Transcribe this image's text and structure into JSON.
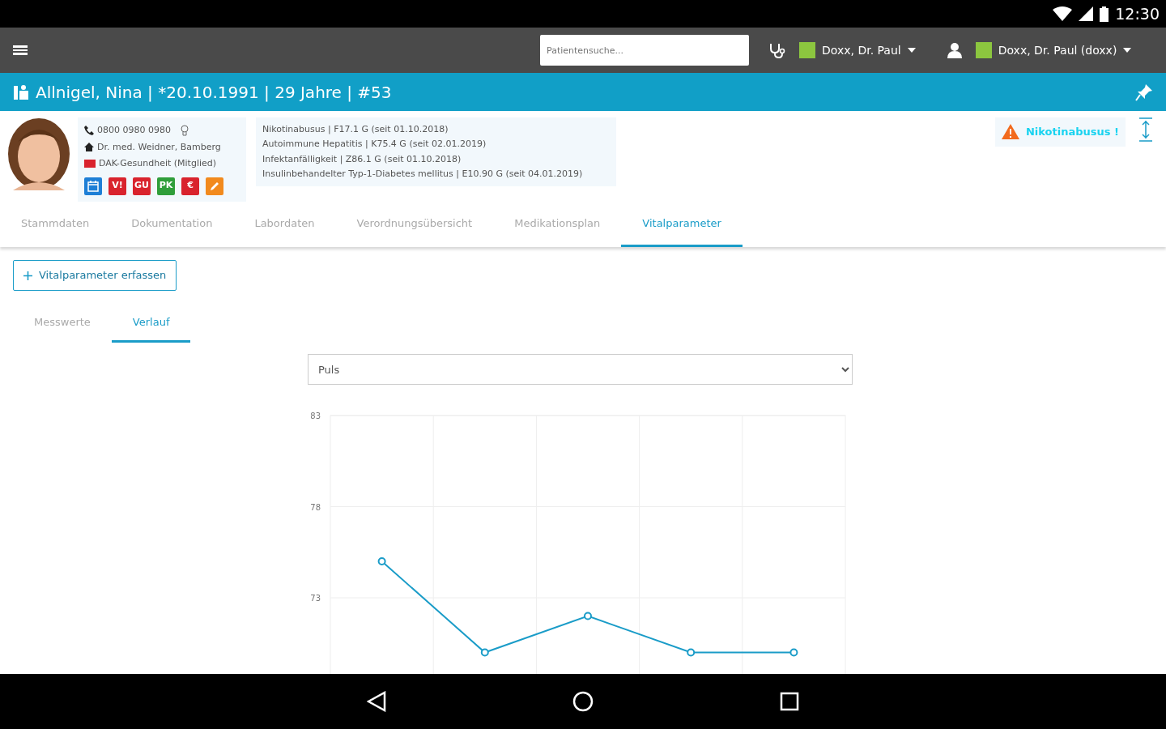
{
  "status_bar": {
    "time": "12:30"
  },
  "toolbar": {
    "search": {
      "placeholder": "Patientensuche..."
    },
    "doctor": {
      "label": "Doxx, Dr. Paul",
      "color": "#8cc63f"
    },
    "user": {
      "label": "Doxx, Dr. Paul (doxx)",
      "color": "#8cc63f"
    }
  },
  "patient": {
    "title": "Allnigel, Nina | *20.10.1991 | 29 Jahre | #53",
    "phone": "0800 0980 0980",
    "doctor": "Dr. med. Weidner, Bamberg",
    "insurance": "DAK-Gesundheit (Mitglied)",
    "badges": [
      {
        "kind": "calendar",
        "color": "#1e7fd6"
      },
      {
        "kind": "text",
        "label": "V!",
        "color": "#d9232d"
      },
      {
        "kind": "text",
        "label": "GU",
        "color": "#d9232d"
      },
      {
        "kind": "text",
        "label": "PK",
        "color": "#2f9e3a"
      },
      {
        "kind": "text",
        "label": "€",
        "color": "#d9232d"
      },
      {
        "kind": "pen",
        "color": "#f28a1d"
      }
    ],
    "diagnoses": [
      "Nikotinabusus | F17.1 G (seit 01.10.2018)",
      "Autoimmune Hepatitis | K75.4 G (seit 02.01.2019)",
      "Infektanfälligkeit | Z86.1 G (seit 01.10.2018)",
      "Insulinbehandelter Typ-1-Diabetes mellitus | E10.90 G (seit 04.01.2019)"
    ],
    "alert": "Nikotinabusus !"
  },
  "tabs": [
    {
      "label": "Stammdaten",
      "selected": false
    },
    {
      "label": "Dokumentation",
      "selected": false
    },
    {
      "label": "Labordaten",
      "selected": false
    },
    {
      "label": "Verordnungsübersicht",
      "selected": false
    },
    {
      "label": "Medikationsplan",
      "selected": false
    },
    {
      "label": "Vitalparameter",
      "selected": true
    }
  ],
  "add_button": "Vitalparameter erfassen",
  "subtabs": [
    {
      "label": "Messwerte",
      "selected": false
    },
    {
      "label": "Verlauf",
      "selected": true
    }
  ],
  "parameter_select": {
    "value": "Puls"
  },
  "chart_data": {
    "type": "line",
    "ylim": [
      68,
      83
    ],
    "yticks": [
      73,
      78,
      83
    ],
    "series": [
      {
        "color": "#1a9cc8",
        "marker": "circle",
        "values": [
          75,
          70,
          72,
          70,
          70
        ]
      }
    ]
  }
}
